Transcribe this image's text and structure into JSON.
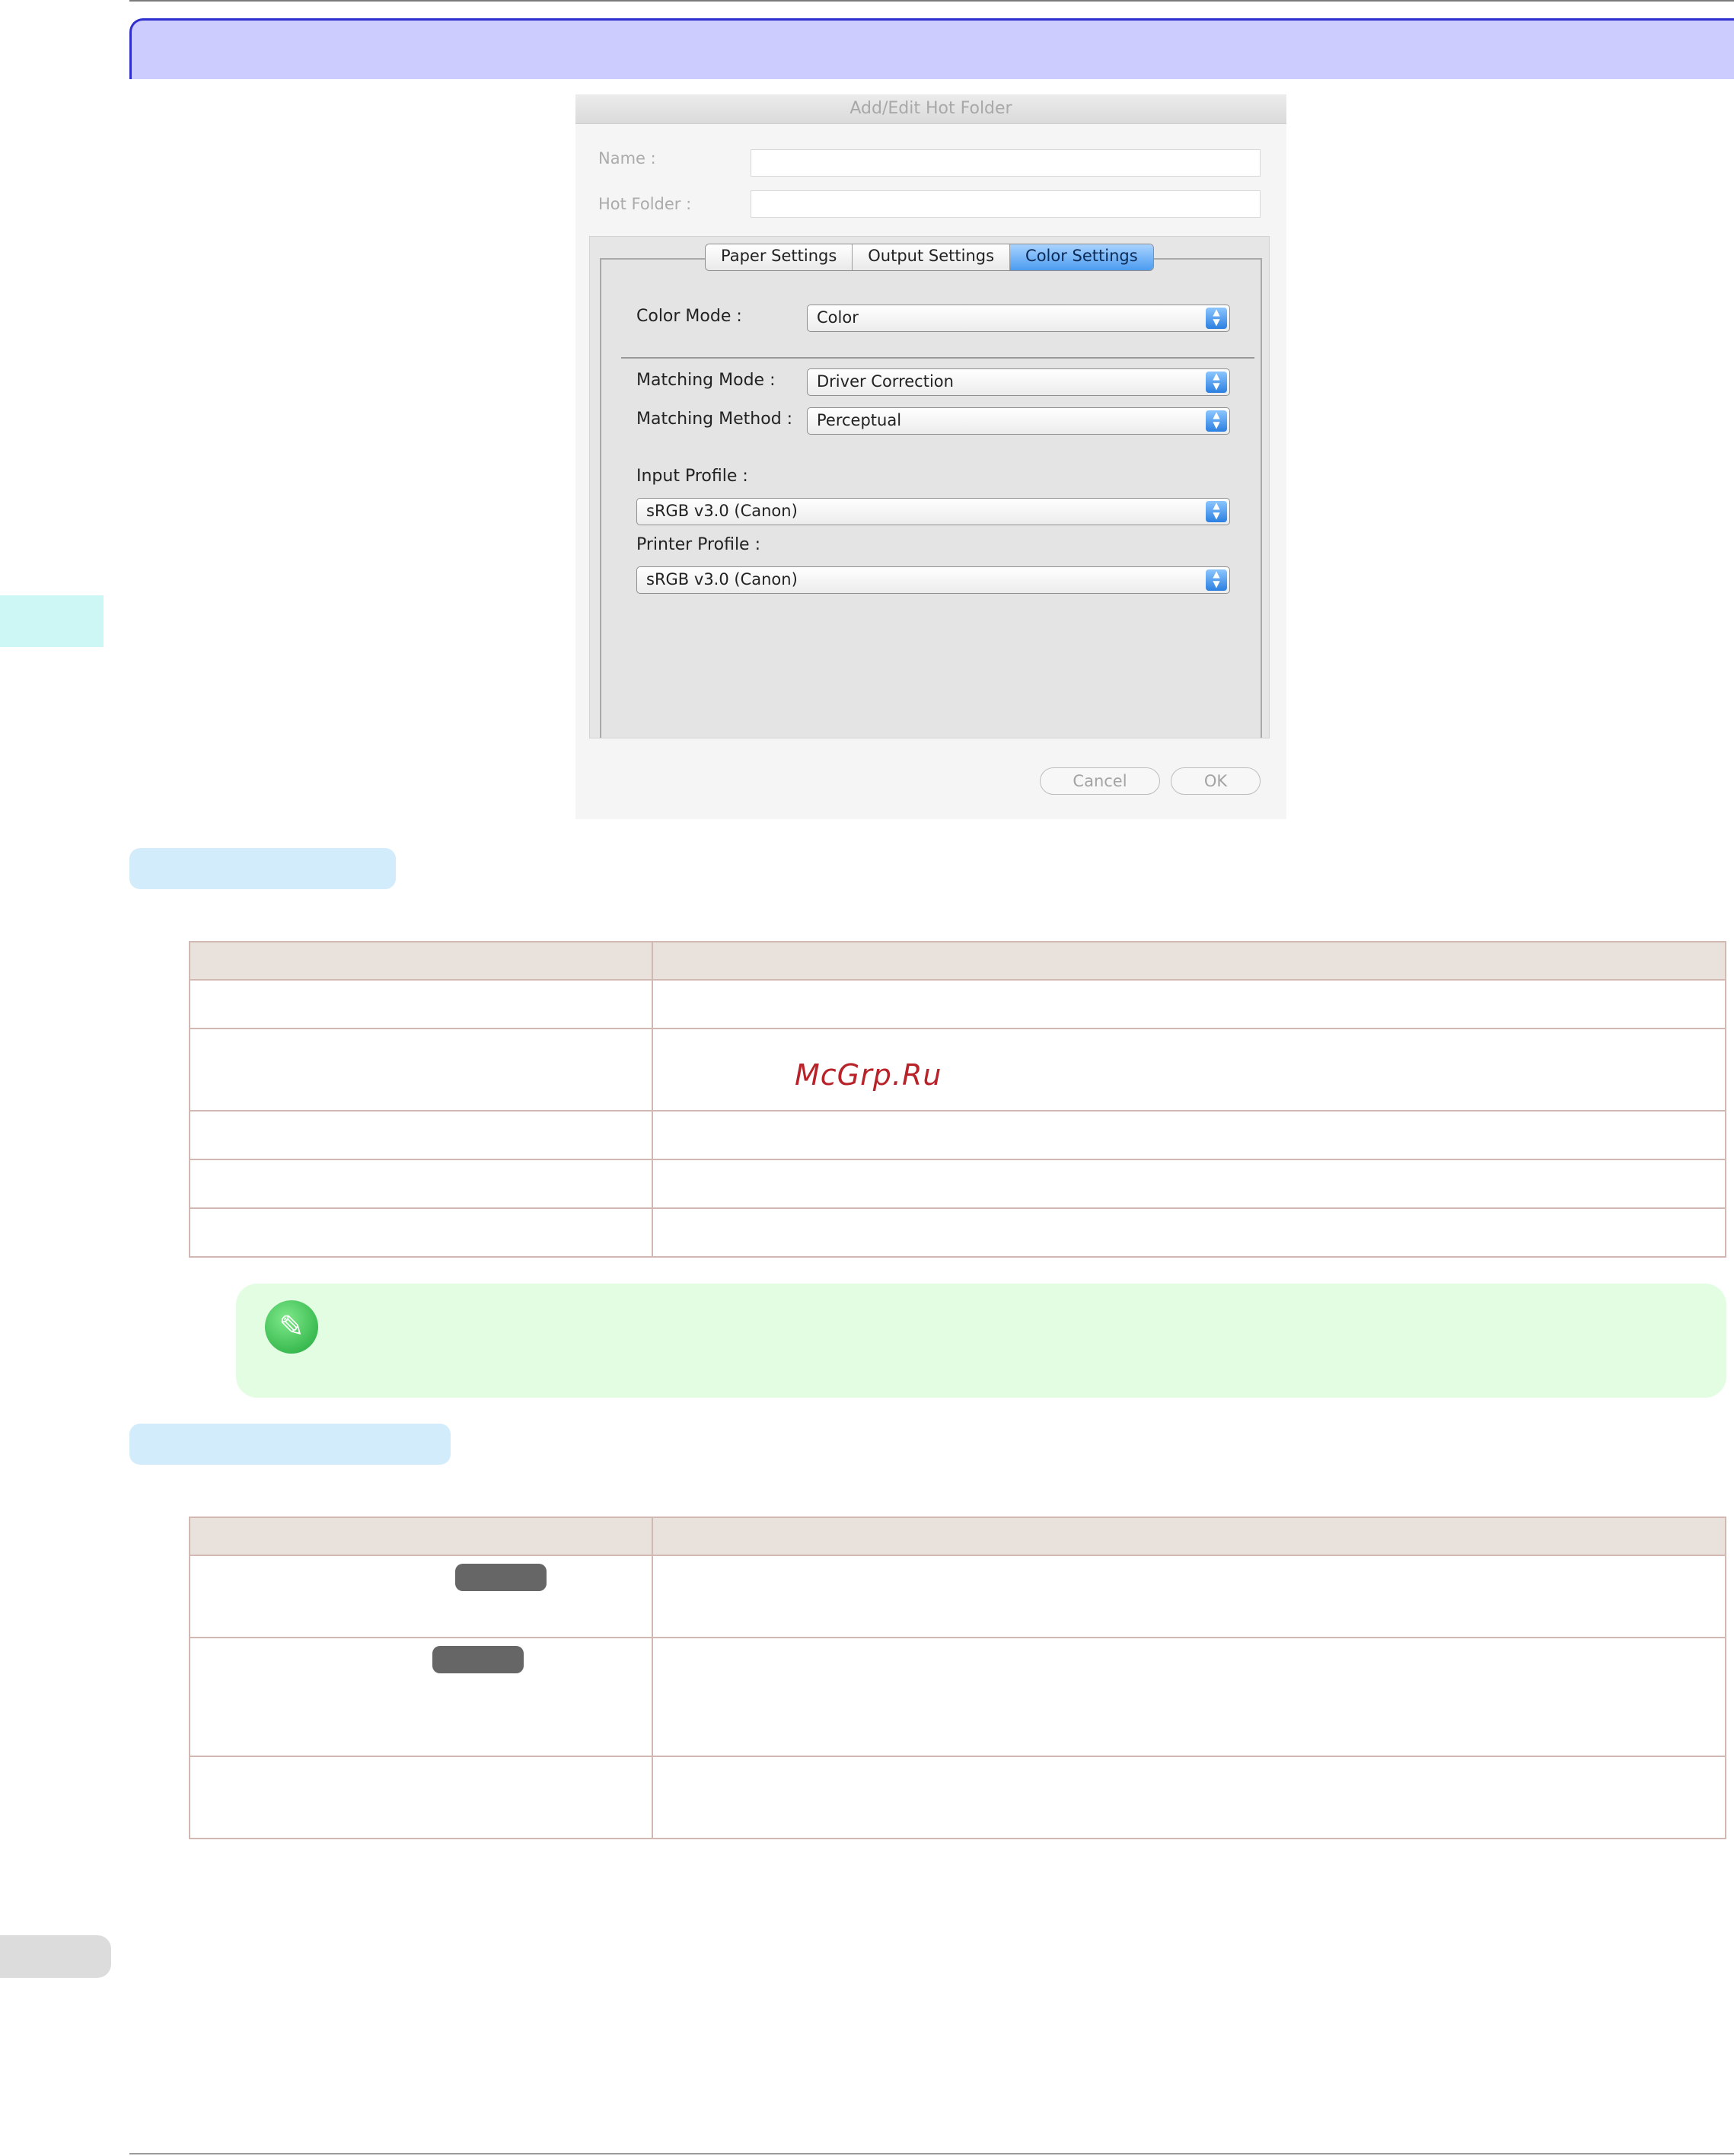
{
  "dialog": {
    "title": "Add/Edit Hot Folder",
    "name_label": "Name :",
    "name_value": "",
    "hot_folder_label": "Hot Folder :",
    "hot_folder_value": "",
    "tabs": [
      "Paper Settings",
      "Output Settings",
      "Color Settings"
    ],
    "active_tab": "Color Settings",
    "color_mode_label": "Color Mode :",
    "color_mode_value": "Color",
    "matching_mode_label": "Matching Mode :",
    "matching_mode_value": "Driver Correction",
    "matching_method_label": "Matching Method :",
    "matching_method_value": "Perceptual",
    "input_profile_label": "Input Profile :",
    "input_profile_value": "sRGB v3.0 (Canon)",
    "printer_profile_label": "Printer Profile :",
    "printer_profile_value": "sRGB v3.0 (Canon)",
    "cancel_label": "Cancel",
    "ok_label": "OK"
  },
  "watermark": "McGrp.Ru",
  "icons": {
    "popup_arrow": "updown-arrows-icon",
    "note": "pencil-note-icon"
  },
  "colors": {
    "banner": "#ccccff",
    "banner_border": "#2f2fcf",
    "section_header": "#d2ecfb",
    "table_header": "#e9e1dc",
    "table_border": "#d2b8b3",
    "note_bg": "#e3fde3",
    "active_tab": "#4c9cf0"
  }
}
